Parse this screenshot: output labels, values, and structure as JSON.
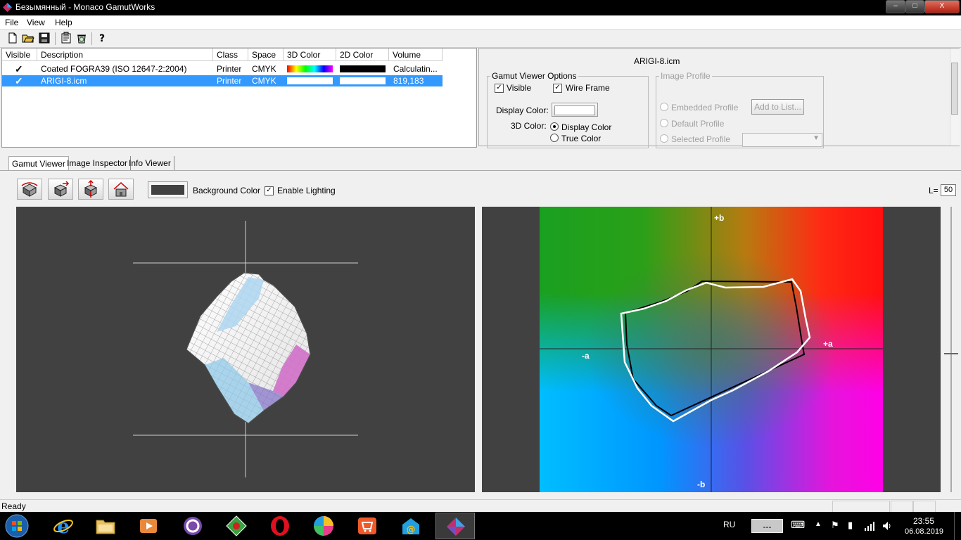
{
  "window": {
    "title": "Безымянный - Monaco GamutWorks",
    "minimize_symbol": "‒",
    "maximize_symbol": "□",
    "close_symbol": "X"
  },
  "menu": [
    "File",
    "View",
    "Help"
  ],
  "toolbar": {
    "icons": [
      "new-icon",
      "open-icon",
      "save-icon",
      "properties-icon",
      "recycle-icon",
      "help-icon"
    ],
    "help_glyph": "?"
  },
  "profiles_table": {
    "columns": [
      "Visible",
      "Description",
      "Class",
      "Space",
      "3D Color",
      "2D Color",
      "Volume"
    ],
    "rows": [
      {
        "visible": true,
        "check": "✓",
        "description": "Coated FOGRA39 (ISO 12647-2:2004)",
        "class": "Printer",
        "space": "CMYK",
        "color3d": "rainbow",
        "color2d": "#000000",
        "volume": "Calculatin...",
        "selected": false
      },
      {
        "visible": true,
        "check": "✓",
        "description": "ARIGI-8.icm",
        "class": "Printer",
        "space": "CMYK",
        "color3d": "#ffffff",
        "color2d": "#ffffff",
        "volume": "819,183",
        "selected": true
      }
    ]
  },
  "options_panel": {
    "profile_name": "ARIGI-8.icm",
    "gamut_viewer_options": {
      "legend": "Gamut Viewer Options",
      "visible_label": "Visible",
      "visible_checked": true,
      "wire_frame_label": "Wire Frame",
      "wire_frame_checked": true,
      "display_color_label": "Display Color:",
      "color3d_label": "3D Color:",
      "color3d_options": [
        "Display Color",
        "True Color"
      ],
      "color3d_selected": "Display Color"
    },
    "image_profile": {
      "legend": "Image Profile",
      "options": [
        "Embedded Profile",
        "Default Profile",
        "Selected Profile"
      ],
      "add_to_list_label": "Add to List..."
    }
  },
  "tabs": [
    "Gamut Viewer",
    "Image Inspector",
    "Info Viewer"
  ],
  "active_tab": "Gamut Viewer",
  "viewer_toolbar": {
    "buttons": [
      "rotate-view-icon",
      "move-view-icon",
      "zoom-view-icon",
      "home-view-icon"
    ],
    "background_color_label": "Background Color",
    "background_color": "#414141",
    "enable_lighting_label": "Enable Lighting",
    "enable_lighting_checked": true,
    "l_label": "L=",
    "l_value": "50"
  },
  "plot2d": {
    "axis_labels": {
      "plus_b": "+b",
      "minus_b": "-b",
      "plus_a": "+a",
      "minus_a": "-a"
    }
  },
  "status": {
    "text": "Ready"
  },
  "taskbar": {
    "apps": [
      "windows-start-icon",
      "internet-explorer-icon",
      "explorer-folder-icon",
      "media-player-icon",
      "circle-app-icon",
      "gamut-green-app-icon",
      "opera-icon",
      "colorful-ball-icon",
      "shop-icon",
      "mail-at-icon",
      "gamutworks-app-icon"
    ],
    "language": "RU",
    "tray_button": "---",
    "time": "23:55",
    "date": "06.08.2019"
  }
}
